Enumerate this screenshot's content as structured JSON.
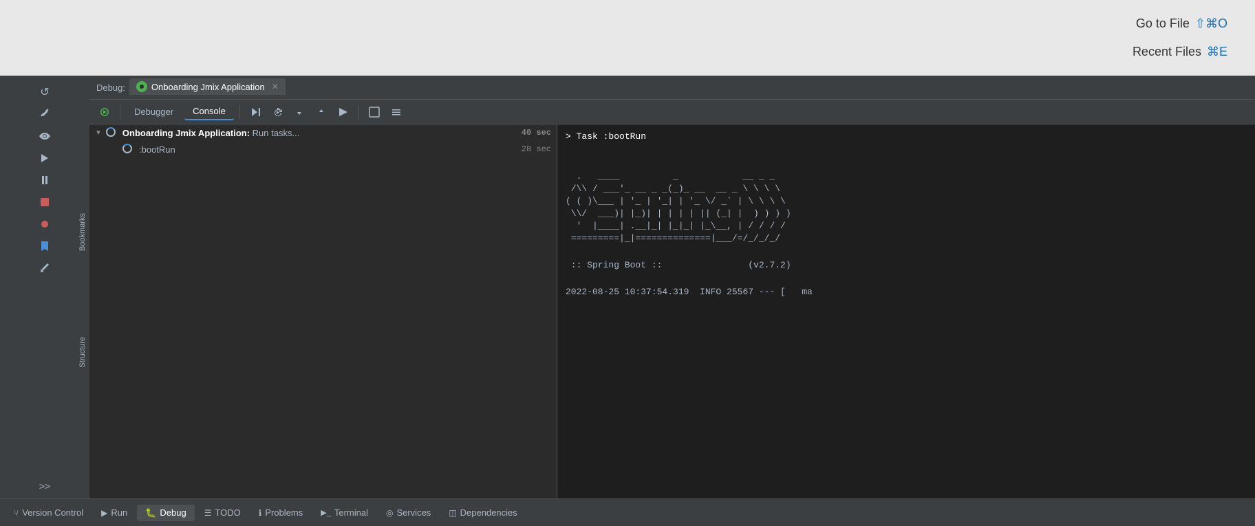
{
  "topArea": {
    "shortcuts": [
      {
        "label": "Go to File",
        "key": "⇧⌘O"
      },
      {
        "label": "Recent Files",
        "key": "⌘E"
      }
    ]
  },
  "debugTabBar": {
    "debugLabel": "Debug:",
    "tabs": [
      {
        "id": "onboarding",
        "label": "Onboarding Jmix Application",
        "active": true,
        "hasIcon": true,
        "closable": true
      }
    ]
  },
  "toolbar": {
    "tabs": [
      {
        "id": "debugger",
        "label": "Debugger",
        "active": false
      },
      {
        "id": "console",
        "label": "Console",
        "active": true
      }
    ],
    "buttons": [
      {
        "id": "rerun",
        "icon": "↺",
        "tooltip": "Rerun"
      },
      {
        "id": "resume",
        "icon": "⏫",
        "tooltip": "Resume"
      },
      {
        "id": "step-over",
        "icon": "⬇",
        "tooltip": "Step Over"
      },
      {
        "id": "step-into",
        "icon": "⬇",
        "tooltip": "Step Into"
      },
      {
        "id": "step-out",
        "icon": "⬆",
        "tooltip": "Step Out"
      },
      {
        "id": "run-to-cursor",
        "icon": "➤",
        "tooltip": "Run to Cursor"
      },
      {
        "id": "evaluate",
        "icon": "▦",
        "tooltip": "Evaluate"
      },
      {
        "id": "more",
        "icon": "☰",
        "tooltip": "More"
      }
    ]
  },
  "taskTree": {
    "items": [
      {
        "id": "main-task",
        "label": "Onboarding Jmix Application:",
        "sublabel": "Run tasks...",
        "time": "40 sec",
        "expanded": true,
        "isMain": true,
        "indent": 0
      },
      {
        "id": "bootrun",
        "label": ":bootRun",
        "time": "28 sec",
        "indent": 1
      }
    ]
  },
  "consoleOutput": {
    "lines": [
      {
        "type": "command",
        "text": "> Task :bootRun"
      },
      {
        "type": "blank",
        "text": ""
      },
      {
        "type": "blank",
        "text": ""
      },
      {
        "type": "ascii",
        "text": "  .   ____          _            __ _ _"
      },
      {
        "type": "ascii-link",
        "linkText": "/\\\\",
        "before": " /\\\\ / ___'_ __ _ _(_)_ __  __ _ \\ \\ \\ \\",
        "hasLink": true
      },
      {
        "type": "ascii",
        "text": "( ( )\\___ | '_ | '_| | '_ \\/ _` | \\ \\ \\ \\"
      },
      {
        "type": "ascii",
        "text": " \\\\/  ___)| |_)| | | | | || (_| |  ) ) ) )"
      },
      {
        "type": "ascii",
        "text": "  '  |____| .__|_| |_|_| |_\\__, | / / / /"
      },
      {
        "type": "ascii",
        "text": " =========|_|==============|___/=/_/_/_/"
      },
      {
        "type": "blank",
        "text": ""
      },
      {
        "type": "info",
        "text": " :: Spring Boot ::                (v2.7.2)"
      },
      {
        "type": "blank",
        "text": ""
      },
      {
        "type": "log",
        "text": "2022-08-25 10:37:54.319  INFO 25567 --- [   ma"
      }
    ]
  },
  "statusBar": {
    "tabs": [
      {
        "id": "version-control",
        "icon": "⑂",
        "label": "Version Control",
        "active": false
      },
      {
        "id": "run",
        "icon": "▶",
        "label": "Run",
        "active": false
      },
      {
        "id": "debug",
        "icon": "🐛",
        "label": "Debug",
        "active": true
      },
      {
        "id": "todo",
        "icon": "☰",
        "label": "TODO",
        "active": false
      },
      {
        "id": "problems",
        "icon": "ℹ",
        "label": "Problems",
        "active": false
      },
      {
        "id": "terminal",
        "icon": "▶_",
        "label": "Terminal",
        "active": false
      },
      {
        "id": "services",
        "icon": "◎",
        "label": "Services",
        "active": false
      },
      {
        "id": "dependencies",
        "icon": "◫",
        "label": "Dependencies",
        "active": false
      }
    ]
  },
  "sidebar": {
    "icons": [
      {
        "id": "rerun-sidebar",
        "icon": "↺"
      },
      {
        "id": "wrench",
        "icon": "🔧"
      },
      {
        "id": "eye",
        "icon": "👁"
      },
      {
        "id": "play",
        "icon": "▶"
      },
      {
        "id": "pause",
        "icon": "⏸"
      },
      {
        "id": "stop",
        "icon": "⏹"
      },
      {
        "id": "record",
        "icon": "⏺"
      },
      {
        "id": "bookmark",
        "icon": "🔖"
      }
    ],
    "bookmarksLabel": "Bookmarks",
    "structureLabel": "Structure",
    "moreLabel": ">>"
  }
}
